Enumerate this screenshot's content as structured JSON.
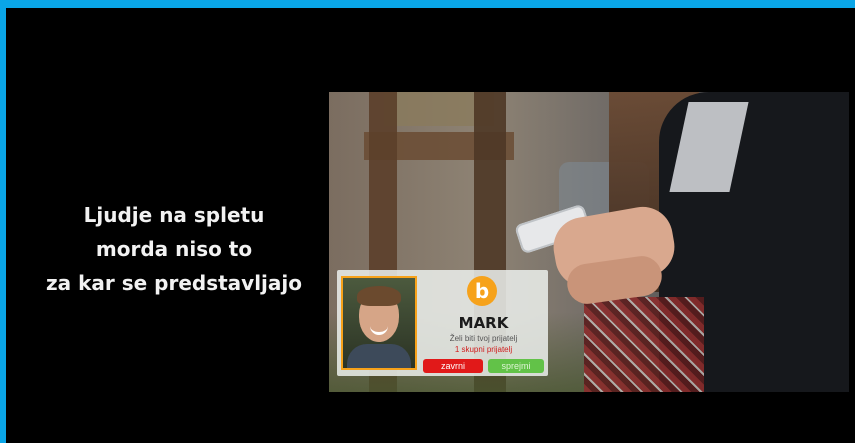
{
  "caption": {
    "lines": [
      "Ljudje na spletu",
      "morda niso to",
      "za kar se predstavljajo"
    ]
  },
  "friend_request": {
    "logo_letter": "b",
    "name": "MARK",
    "question": "Želi biti tvoj prijatelj",
    "mutual": "1 skupni prijatelj",
    "decline_label": "zavrni",
    "accept_label": "sprejmi",
    "colors": {
      "accent": "#f6a21b",
      "decline": "#e11919",
      "accept": "#62c248"
    }
  },
  "icons": [
    "logo-b-icon",
    "avatar-photo"
  ]
}
